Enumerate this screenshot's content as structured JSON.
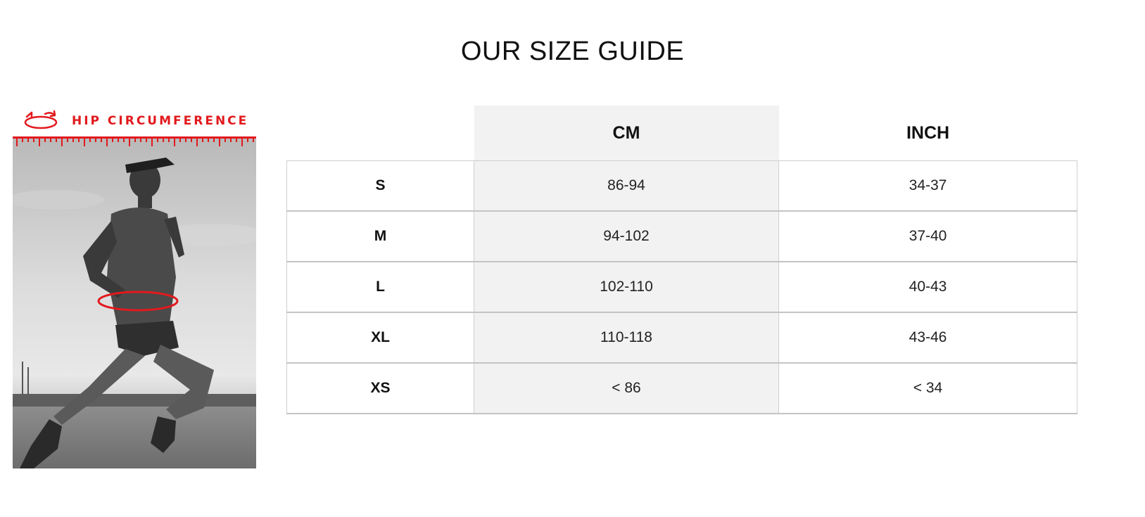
{
  "page": {
    "title": "OUR SIZE GUIDE"
  },
  "figure": {
    "label": "HIP CIRCUMFERENCE",
    "accent_color": "#e2191d",
    "icon": "rotate-arrows-icon",
    "image": "runner-photo"
  },
  "table": {
    "columns": [
      "",
      "CM",
      "INCH"
    ],
    "rows": [
      {
        "size": "S",
        "cm": "86-94",
        "inch": "34-37"
      },
      {
        "size": "M",
        "cm": "94-102",
        "inch": "37-40"
      },
      {
        "size": "L",
        "cm": "102-110",
        "inch": "40-43"
      },
      {
        "size": "XL",
        "cm": "110-118",
        "inch": "43-46"
      },
      {
        "size": "XS",
        "cm": "< 86",
        "inch": "< 34"
      }
    ],
    "shaded_column_color": "#f2f2f2"
  }
}
